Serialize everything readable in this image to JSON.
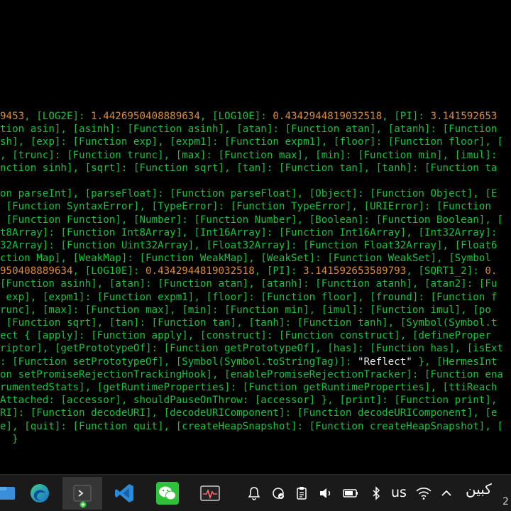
{
  "terminal": {
    "lines": [
      [
        [
          "o",
          "9453"
        ],
        [
          "g",
          ", [LOG2E]: "
        ],
        [
          "o",
          "1.4426950408889634"
        ],
        [
          "g",
          ", [LOG10E]: "
        ],
        [
          "o",
          "0.4342944819032518"
        ],
        [
          "g",
          ", [PI]: "
        ],
        [
          "o",
          "3.141592653"
        ]
      ],
      [
        [
          "g",
          "tion asin], [asinh]: [Function asinh], [atan]: [Function atan], [atanh]: [Function"
        ]
      ],
      [
        [
          "g",
          "sh], [exp]: [Function exp], [expm1]: [Function expm1], [floor]: [Function floor], ["
        ]
      ],
      [
        [
          "g",
          ", [trunc]: [Function trunc], [max]: [Function max], [min]: [Function min], [imul]:"
        ]
      ],
      [
        [
          "g",
          "nction sinh], [sqrt]: [Function sqrt], [tan]: [Function tan], [tanh]: [Function ta"
        ]
      ],
      [
        [
          "g",
          ""
        ]
      ],
      [
        [
          "g",
          "on parseInt], [parseFloat]: [Function parseFloat], [Object]: [Function Object], [E"
        ]
      ],
      [
        [
          "g",
          " [Function SyntaxError], [TypeError]: [Function TypeError], [URIError]: [Function"
        ]
      ],
      [
        [
          "g",
          " [Function Function], [Number]: [Function Number], [Boolean]: [Function Boolean], ["
        ]
      ],
      [
        [
          "g",
          "t8Array]: [Function Int8Array], [Int16Array]: [Function Int16Array], [Int32Array]:"
        ]
      ],
      [
        [
          "g",
          "32Array]: [Function Uint32Array], [Float32Array]: [Function Float32Array], [Float6"
        ]
      ],
      [
        [
          "g",
          "ction Map], [WeakMap]: [Function WeakMap], [WeakSet]: [Function WeakSet], [Symbol"
        ]
      ],
      [
        [
          "o",
          "950408889634"
        ],
        [
          "g",
          ", [LOG10E]: "
        ],
        [
          "o",
          "0.4342944819032518"
        ],
        [
          "g",
          ", [PI]: "
        ],
        [
          "o",
          "3.141592653589793"
        ],
        [
          "g",
          ", [SQRT1_2]: "
        ],
        [
          "o",
          "0."
        ]
      ],
      [
        [
          "g",
          "[Function asinh], [atan]: [Function atan], [atanh]: [Function atanh], [atan2]: [Fu"
        ]
      ],
      [
        [
          "g",
          " exp], [expm1]: [Function expm1], [floor]: [Function floor], [fround]: [Function f"
        ]
      ],
      [
        [
          "g",
          "runc], [max]: [Function max], [min]: [Function min], [imul]: [Function imul], [po"
        ]
      ],
      [
        [
          "g",
          " [Function sqrt], [tan]: [Function tan], [tanh]: [Function tanh], [Symbol(Symbol.t"
        ]
      ],
      [
        [
          "g",
          "ect { [apply]: [Function apply], [construct]: [Function construct], [defineProper"
        ]
      ],
      [
        [
          "g",
          "riptor], [getPrototypeOf]: [Function getPrototypeOf], [has]: [Function has], [isExt"
        ]
      ],
      [
        [
          "g",
          ": [Function setPrototypeOf], [Symbol(Symbol.toStringTag)]: "
        ],
        [
          "w",
          "\"Reflect\""
        ],
        [
          "g",
          " }, [HermesInt"
        ]
      ],
      [
        [
          "g",
          "on setPromiseRejectionTrackingHook], [enablePromiseRejectionTracker]: [Function ena"
        ]
      ],
      [
        [
          "g",
          "rumentedStats], [getRuntimeProperties]: [Function getRuntimeProperties], [ttiReach"
        ]
      ],
      [
        [
          "g",
          "Attached: [accessor], shouldPauseOnThrow: [accessor] }, [print]: [Function print],"
        ]
      ],
      [
        [
          "g",
          "RI]: [Function decodeURI], [decodeURIComponent]: [Function decodeURIComponent], [e"
        ]
      ],
      [
        [
          "g",
          "e], [quit]: [Function quit], [createHeapSnapshot]: [Function createHeapSnapshot], ["
        ]
      ],
      [
        [
          "g",
          "  }"
        ]
      ]
    ]
  },
  "taskbar": {
    "apps": [
      {
        "name": "file-explorer-icon"
      },
      {
        "name": "edge-icon"
      },
      {
        "name": "terminal-icon",
        "active": true
      },
      {
        "name": "vscode-icon"
      },
      {
        "name": "wechat-icon"
      },
      {
        "name": "activity-monitor-icon"
      }
    ],
    "tray": {
      "language": "us",
      "clock_text": "کبین",
      "clock_sub": "2"
    },
    "colors": {
      "edge": "#2f86d6",
      "vscode": "#2a8bd8",
      "wechat": "#2ec23a",
      "terminal_accent": "#7fb3e6"
    }
  }
}
